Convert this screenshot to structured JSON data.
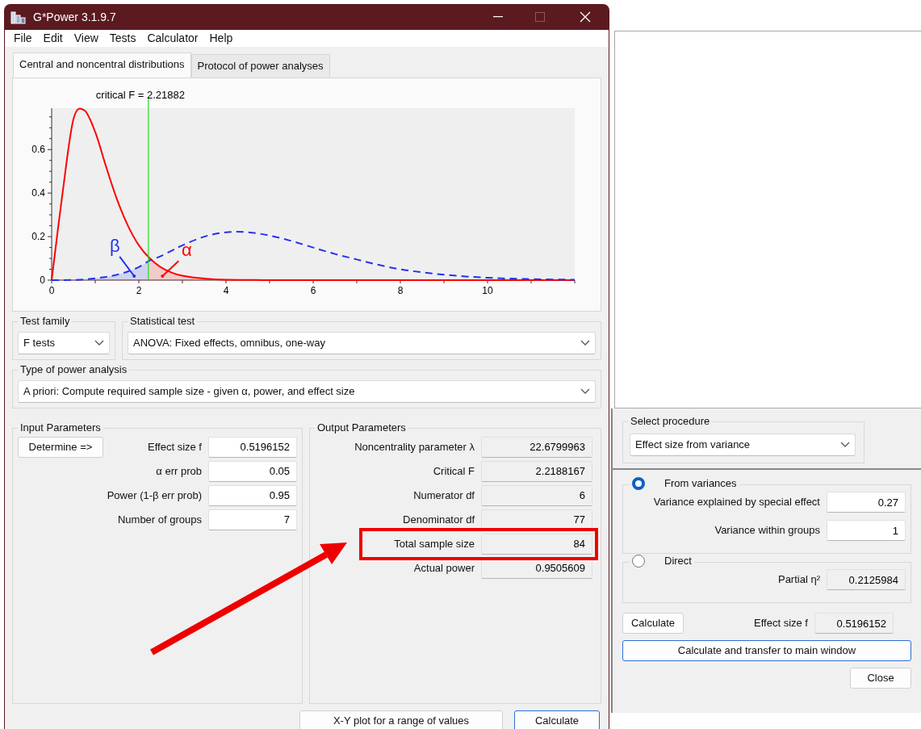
{
  "window": {
    "title": "G*Power 3.1.9.7"
  },
  "menu": [
    "File",
    "Edit",
    "View",
    "Tests",
    "Calculator",
    "Help"
  ],
  "tabs": [
    {
      "label": "Central and noncentral distributions",
      "selected": true
    },
    {
      "label": "Protocol of power analyses",
      "selected": false
    }
  ],
  "chart": {
    "chart_data": {
      "type": "line",
      "x": [
        0,
        0.25,
        0.5,
        0.75,
        1,
        1.25,
        1.5,
        1.75,
        2,
        2.25,
        2.5,
        2.75,
        3,
        3.5,
        4,
        4.5,
        5,
        5.5,
        6,
        6.5,
        7,
        7.5,
        8,
        8.5,
        9,
        9.5,
        10,
        10.5,
        11,
        11.5,
        12
      ],
      "series": [
        {
          "color": "#ff0000",
          "line_style": "solid",
          "values": [
            0,
            0.4,
            0.74,
            0.78,
            0.68,
            0.52,
            0.37,
            0.25,
            0.16,
            0.1,
            0.06,
            0.035,
            0.02,
            0.007,
            0.002,
            0.001,
            0,
            0,
            0,
            0,
            0,
            0,
            0,
            0,
            0,
            0,
            0,
            0,
            0,
            0,
            0
          ]
        },
        {
          "color": "#2233ee",
          "line_style": "dashed",
          "values": [
            0,
            0,
            0.001,
            0.003,
            0.008,
            0.015,
            0.025,
            0.04,
            0.06,
            0.09,
            0.11,
            0.135,
            0.16,
            0.2,
            0.22,
            0.22,
            0.205,
            0.18,
            0.15,
            0.12,
            0.095,
            0.07,
            0.05,
            0.036,
            0.025,
            0.017,
            0.011,
            0.007,
            0.005,
            0.003,
            0.002
          ]
        }
      ],
      "xlim": [
        0,
        12
      ],
      "ylim": [
        0,
        0.79
      ],
      "xticks": [
        0,
        2,
        4,
        6,
        8,
        10
      ],
      "yticks": [
        0,
        0.2,
        0.4,
        0.6
      ],
      "ref_lines": [
        {
          "axis": "x",
          "value": 2.21882,
          "label": "critical F = 2.21882"
        }
      ],
      "annotations": [
        "β",
        "α"
      ]
    }
  },
  "test_family": {
    "label": "Test family",
    "value": "F tests"
  },
  "statistical_test": {
    "label": "Statistical test",
    "value": "ANOVA: Fixed effects, omnibus, one-way"
  },
  "power_analysis_type": {
    "label": "Type of power analysis",
    "value": "A priori: Compute required sample size - given α, power, and effect size"
  },
  "input_parameters": {
    "title": "Input Parameters",
    "determine_button": "Determine =>",
    "fields": [
      {
        "label": "Effect size f",
        "value": "0.5196152"
      },
      {
        "label": "α err prob",
        "value": "0.05"
      },
      {
        "label": "Power (1-β err prob)",
        "value": "0.95"
      },
      {
        "label": "Number of groups",
        "value": "7"
      }
    ]
  },
  "output_parameters": {
    "title": "Output Parameters",
    "fields": [
      {
        "label": "Noncentrality parameter λ",
        "value": "22.6799963",
        "highlighted": false
      },
      {
        "label": "Critical F",
        "value": "2.2188167",
        "highlighted": false
      },
      {
        "label": "Numerator df",
        "value": "6",
        "highlighted": false
      },
      {
        "label": "Denominator df",
        "value": "77",
        "highlighted": false
      },
      {
        "label": "Total sample size",
        "value": "84",
        "highlighted": true
      },
      {
        "label": "Actual power",
        "value": "0.9505609",
        "highlighted": false
      }
    ]
  },
  "pointer_arrow": true,
  "buttons": [
    {
      "label": "X-Y plot for a range of values",
      "default": false
    },
    {
      "label": "Calculate",
      "default": true
    }
  ],
  "effect_size_dialog": {
    "procedure": {
      "label": "Select procedure",
      "value": "Effect size from variance"
    },
    "options": [
      {
        "label": "From variances",
        "selected": true,
        "fields": [
          {
            "label": "Variance explained by special effect",
            "value": "0.27",
            "editable": true
          },
          {
            "label": "Variance within groups",
            "value": "1",
            "editable": true
          }
        ]
      },
      {
        "label": "Direct",
        "selected": false,
        "fields": [
          {
            "label": "Partial η²",
            "value": "0.2125984",
            "editable": false
          }
        ]
      }
    ],
    "calculate_button": "Calculate",
    "result": {
      "label": "Effect size f",
      "value": "0.5196152"
    },
    "transfer_button": "Calculate and transfer to main window",
    "close_button": "Close"
  }
}
